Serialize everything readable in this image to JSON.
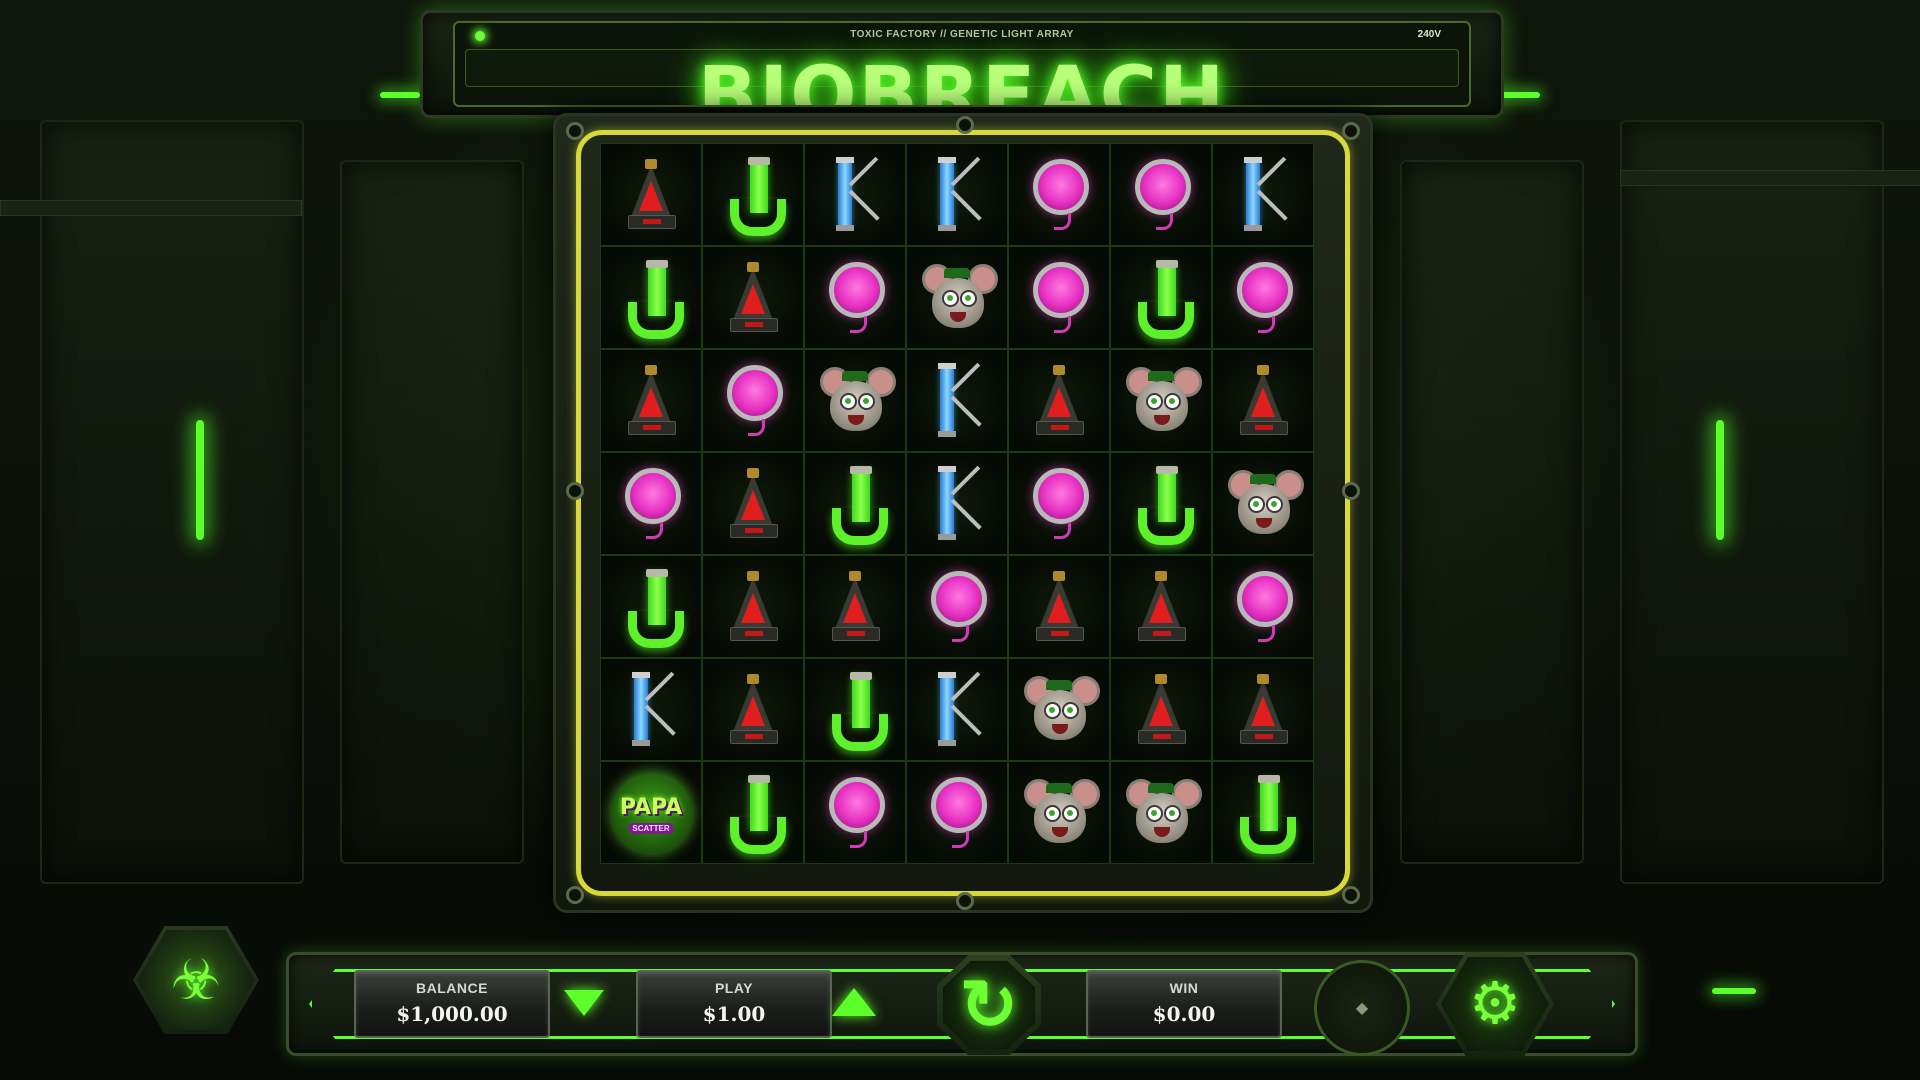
{
  "header": {
    "subtitle": "TOXIC FACTORY // GENETIC LIGHT ARRAY",
    "voltage": "240V",
    "title": "BIOBREACH"
  },
  "grid": {
    "columns": 7,
    "rows": [
      [
        "A",
        "J",
        "K",
        "K",
        "Q",
        "Q",
        "K"
      ],
      [
        "J",
        "A",
        "Q",
        "RAT",
        "Q",
        "J",
        "Q"
      ],
      [
        "A",
        "Q",
        "RAT",
        "K",
        "A",
        "RAT",
        "A"
      ],
      [
        "Q",
        "A",
        "J",
        "K",
        "Q",
        "J",
        "RAT"
      ],
      [
        "J",
        "A",
        "A",
        "Q",
        "A",
        "A",
        "Q"
      ],
      [
        "K",
        "A",
        "J",
        "K",
        "RAT",
        "A",
        "A"
      ],
      [
        "PAPA",
        "J",
        "Q",
        "Q",
        "RAT",
        "RAT",
        "J"
      ]
    ],
    "symbol_names": {
      "A": "red-flask-a-icon",
      "J": "green-tube-j-icon",
      "K": "blue-vial-k-icon",
      "Q": "pink-orb-q-icon",
      "RAT": "lab-rat-icon",
      "PAPA": "papa-scatter-icon"
    },
    "scatter": {
      "word": "PAPA",
      "tag": "SCATTER"
    }
  },
  "controls": {
    "balance_label": "BALANCE",
    "balance_value": "$1,000.00",
    "play_label": "PLAY",
    "play_value": "$1.00",
    "win_label": "WIN",
    "win_value": "$0.00"
  },
  "icons": {
    "biohazard": "☣",
    "spin": "↻",
    "settings": "⚙",
    "autoplay": "◆"
  },
  "colors": {
    "accent": "#5dff2a",
    "frame_line": "#d8d83a"
  }
}
